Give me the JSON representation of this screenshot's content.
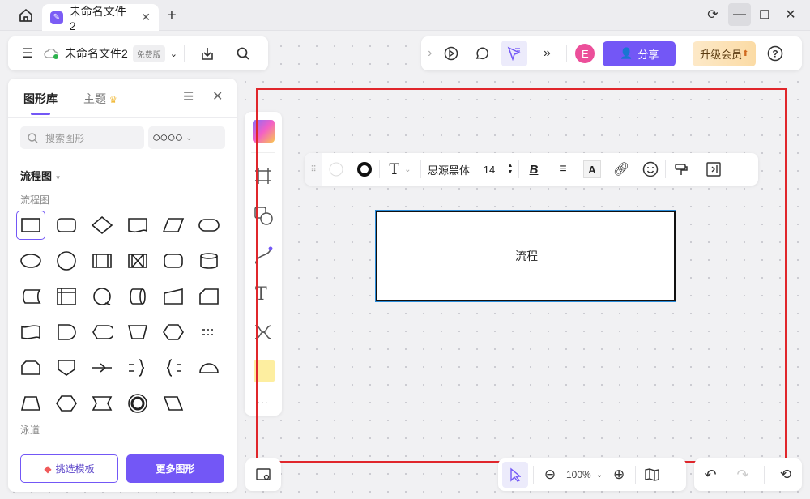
{
  "titlebar": {
    "tab_title": "未命名文件2",
    "home": "home-icon",
    "new_tab": "+"
  },
  "filebar": {
    "name": "未命名文件2",
    "badge": "免费版"
  },
  "topright": {
    "avatar": "E",
    "share": "分享",
    "upgrade": "升级会员"
  },
  "format": {
    "font": "思源黑体",
    "size": "14"
  },
  "panel": {
    "tab_library": "图形库",
    "tab_theme": "主题",
    "search_placeholder": "搜索图形",
    "category": "流程图",
    "section": "流程图",
    "section2": "泳道",
    "btn_template": "挑选模板",
    "btn_more": "更多图形"
  },
  "canvas": {
    "shape_text": "流程"
  },
  "bottom": {
    "zoom": "100%"
  },
  "colors": {
    "accent": "#7357f6",
    "selection": "#e0262b"
  }
}
